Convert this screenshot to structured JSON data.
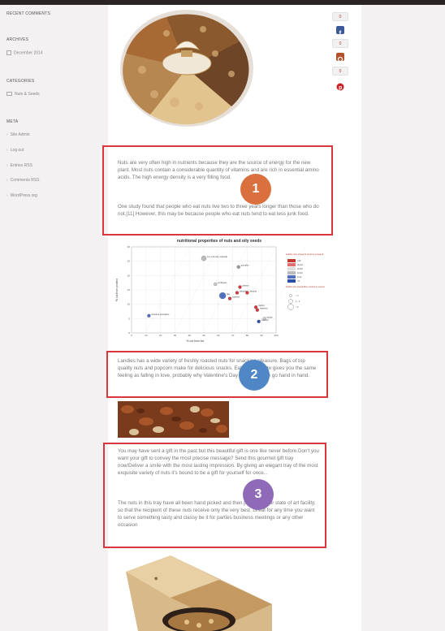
{
  "sidebar": {
    "recent_comments_heading": "RECENT COMMENTS",
    "archives_heading": "ARCHIVES",
    "archives_items": [
      "December 2014"
    ],
    "categories_heading": "CATEGORIES",
    "categories_items": [
      "Nuts & Seeds"
    ],
    "meta_heading": "META",
    "meta_items": [
      "Site Admin",
      "Log out",
      "Entries RSS",
      "Comments RSS",
      "WordPress.org"
    ]
  },
  "share": {
    "counts": [
      "0",
      "0",
      "0",
      "0"
    ],
    "icons": [
      "facebook-icon",
      "stumbleupon-icon",
      "pinterest-icon"
    ],
    "colors": {
      "facebook": "#3b5998",
      "stumble": "#b4512b",
      "pinterest": "#cb2027"
    }
  },
  "article": {
    "para1a": "Nuts are very often high in nutrients because they are the source of energy for the new plant. Most nuts contain a considerable quantity of vitamins and are rich in essential amino acids. The high energy density is a very filling food.",
    "para1b": "One study found that people who eat nuts live two to three years longer than those who do not.[11] However, this may be because people who eat nuts tend to eat less junk food.",
    "para2": "Landies has a wide variety of freshly roasted nuts for snacking pleasure. Bags of top quality nuts and popcorn make for delicious snacks. Eating chocolate gives you the same feeling as falling in love, probably why Valentine's Day and chocolate go hand in hand.",
    "para3a": "You may have sent a gift in the past but this beautiful gift is one like never before.Don't you want your gift to convey the most precise message? Send this gourmet gift tray now!Deliver a smile with the most lasting impression. By giving an elegant tray of the most exquisite variety of nuts it's bound to be a gift for yourself for once...",
    "para3b": "The nuts in this tray have all been hand picked and then packed in our state of art facility, so that the recipient of these nuts receive only the very best .Great for any time you want to serve something tasty and classy be it for parties business meetings or any other occasion"
  },
  "annotations": [
    {
      "label": "1",
      "color": "#d9703e"
    },
    {
      "label": "2",
      "color": "#4f86c6"
    },
    {
      "label": "3",
      "color": "#8e6ab8"
    }
  ],
  "chart_data": {
    "type": "scatter",
    "title": "nutritional properties of nuts and oily seeds",
    "xlabel": "% cal from fat",
    "ylabel": "% cal from protein",
    "xlim": [
      0,
      100
    ],
    "ylim": [
      0,
      30
    ],
    "xticks": [
      "0",
      "10",
      "20",
      "30",
      "40",
      "50",
      "60",
      "70",
      "80",
      "90",
      "100"
    ],
    "yticks": [
      "0",
      "5",
      "10",
      "15",
      "20",
      "25",
      "30"
    ],
    "points": [
      {
        "label": "soy nuts (dry roasted)",
        "x": 50,
        "y": 26,
        "color": "#bbbbbb",
        "size": 3
      },
      {
        "label": "pumpkin",
        "x": 74,
        "y": 23,
        "color": "#999999",
        "size": 2
      },
      {
        "label": "sunflower",
        "x": 58,
        "y": 17,
        "color": "#cccccc",
        "size": 2
      },
      {
        "label": "peanut",
        "x": 75,
        "y": 16,
        "color": "#d9363e",
        "size": 2
      },
      {
        "label": "pistachio",
        "x": 73,
        "y": 14,
        "color": "#d9363e",
        "size": 2
      },
      {
        "label": "almond",
        "x": 80,
        "y": 14,
        "color": "#d9363e",
        "size": 2
      },
      {
        "label": "flax",
        "x": 63,
        "y": 13,
        "color": "#4f6fbf",
        "size": 4
      },
      {
        "label": "cashew",
        "x": 68,
        "y": 12,
        "color": "#d9363e",
        "size": 2
      },
      {
        "label": "walnut",
        "x": 86,
        "y": 9,
        "color": "#d9363e",
        "size": 2
      },
      {
        "label": "hazelnut",
        "x": 87,
        "y": 8,
        "color": "#d9363e",
        "size": 2
      },
      {
        "label": "pecan",
        "x": 92,
        "y": 5,
        "color": "#cccccc",
        "size": 2
      },
      {
        "label": "chestnut (pumpkin)",
        "x": 12,
        "y": 6,
        "color": "#4f6fbf",
        "size": 2
      },
      {
        "label": "coconut",
        "x": 88,
        "y": 4,
        "color": "#2b4fa8",
        "size": 2
      }
    ],
    "legend": {
      "color_title": "bubble color shows % cal from omega-6",
      "color_items": [
        {
          "label": ">40",
          "color": "#c0392b"
        },
        {
          "label": "30-40",
          "color": "#e07070"
        },
        {
          "label": "20-30",
          "color": "#dddddd"
        },
        {
          "label": "10-20",
          "color": "#bbbbbb"
        },
        {
          "label": "5-10",
          "color": "#4f6fbf"
        },
        {
          "label": "<5",
          "color": "#2b4fa8"
        }
      ],
      "size_title": "bubble size shows fiber content in grams/100cal",
      "size_items": [
        "< 1",
        "1 - 2",
        "> 2"
      ],
      "placement": "right"
    }
  }
}
